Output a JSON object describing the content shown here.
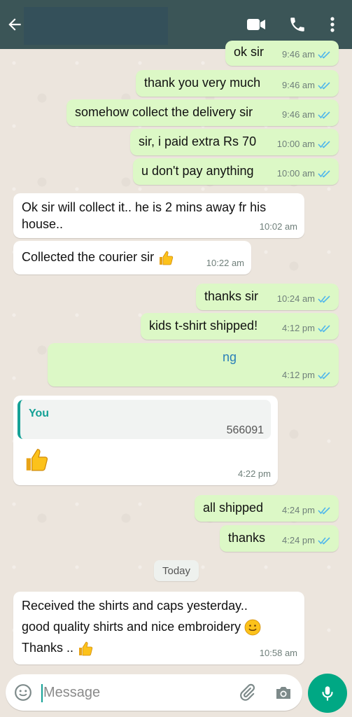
{
  "header": {
    "icons": [
      "arrow-left-icon",
      "video-call-icon",
      "phone-icon",
      "more-vert-icon"
    ]
  },
  "messages": [
    {
      "text": "ok sir",
      "time": "9:46 am",
      "dir": "out"
    },
    {
      "text": "thank you very much",
      "time": "9:46 am",
      "dir": "out"
    },
    {
      "text": "somehow collect the delivery sir",
      "time": "9:46 am",
      "dir": "out"
    },
    {
      "text": "sir, i paid extra Rs 70",
      "time": "10:00 am",
      "dir": "out"
    },
    {
      "text": "u don't pay anything",
      "time": "10:00 am",
      "dir": "out"
    },
    {
      "text_line1": "Ok sir will collect it.. he is 2 mins away fr his",
      "text_line2": "house..",
      "time": "10:02 am",
      "dir": "in"
    },
    {
      "text": "Collected the courier sir",
      "time": "10:22 am",
      "dir": "in"
    },
    {
      "text": "thanks sir",
      "time": "10:24 am",
      "dir": "out"
    },
    {
      "text": "kids t-shirt shipped!",
      "time": "4:12 pm",
      "dir": "out"
    },
    {
      "text": "ng",
      "time": "4:12 pm",
      "dir": "out"
    },
    {
      "quote_name": "You",
      "quote_text": "566091",
      "time": "4:22 pm",
      "dir": "in"
    },
    {
      "text": "all shipped",
      "time": "4:24 pm",
      "dir": "out"
    },
    {
      "text": "thanks",
      "time": "4:24 pm",
      "dir": "out"
    },
    {
      "text_line1": "Received the shirts and caps yesterday..",
      "text_line2": "good quality shirts and nice embroidery",
      "text_line3": "Thanks ..",
      "time": "10:58 am",
      "dir": "in"
    }
  ],
  "day_separator": "Today",
  "composer": {
    "placeholder": "Message"
  },
  "colors": {
    "header_bg": "#3b5557",
    "outgoing_bubble": "#dcf8c6",
    "incoming_bubble": "#ffffff",
    "read_tick": "#4fb6ec",
    "accent": "#00a884"
  }
}
